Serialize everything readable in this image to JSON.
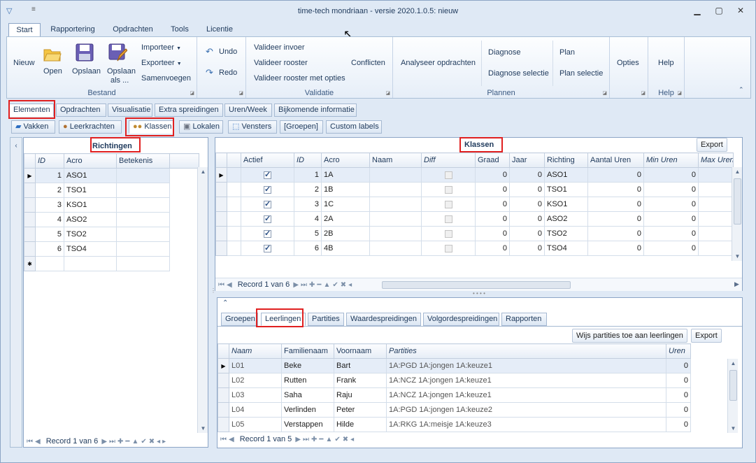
{
  "app": {
    "title": "time-tech mondriaan - versie 2020.1.0.5: nieuw"
  },
  "ribbon_tabs": [
    "Start",
    "Rapportering",
    "Opdrachten",
    "Tools",
    "Licentie"
  ],
  "ribbon": {
    "bestand": {
      "caption": "Bestand",
      "nieuw": "Nieuw",
      "open": "Open",
      "opslaan": "Opslaan",
      "opslaan_als_1": "Opslaan",
      "opslaan_als_2": "als ...",
      "importeer": "Importeer",
      "exporteer": "Exporteer",
      "samenvoegen": "Samenvoegen"
    },
    "undo": "Undo",
    "redo": "Redo",
    "validatie": {
      "caption": "Validatie",
      "valideer_invoer": "Valideer invoer",
      "valideer_rooster": "Valideer rooster",
      "valideer_opties": "Valideer rooster met opties",
      "conflicten": "Conflicten"
    },
    "plannen": {
      "caption": "Plannen",
      "analyseer": "Analyseer opdrachten",
      "diagnose": "Diagnose",
      "diagnose_selectie": "Diagnose selectie",
      "plan": "Plan",
      "plan_selectie": "Plan selectie"
    },
    "opties": "Opties",
    "help": {
      "caption": "Help",
      "label": "Help"
    }
  },
  "main_tabs": [
    "Elementen",
    "Opdrachten",
    "Visualisatie",
    "Extra spreidingen",
    "Uren/Week",
    "Bijkomende informatie"
  ],
  "element_tabs": [
    "Vakken",
    "Leerkrachten",
    "Klassen",
    "Lokalen",
    "Vensters",
    "[Groepen]",
    "Custom labels"
  ],
  "richtingen": {
    "title": "Richtingen",
    "columns": [
      "ID",
      "Acro",
      "Betekenis"
    ],
    "rows": [
      {
        "id": "1",
        "acro": "ASO1"
      },
      {
        "id": "2",
        "acro": "TSO1"
      },
      {
        "id": "3",
        "acro": "KSO1"
      },
      {
        "id": "4",
        "acro": "ASO2"
      },
      {
        "id": "5",
        "acro": "TSO2"
      },
      {
        "id": "6",
        "acro": "TSO4"
      }
    ],
    "record": "Record 1 van 6"
  },
  "klassen": {
    "title": "Klassen",
    "export": "Export",
    "columns": [
      "Actief",
      "ID",
      "Acro",
      "Naam",
      "Diff",
      "Graad",
      "Jaar",
      "Richting",
      "Aantal Uren",
      "Min Uren",
      "Max Uren"
    ],
    "rows": [
      {
        "actief": true,
        "id": "1",
        "acro": "1A",
        "graad": "0",
        "jaar": "0",
        "richting": "ASO1",
        "aantal": "0",
        "min": "0"
      },
      {
        "actief": true,
        "id": "2",
        "acro": "1B",
        "graad": "0",
        "jaar": "0",
        "richting": "TSO1",
        "aantal": "0",
        "min": "0"
      },
      {
        "actief": true,
        "id": "3",
        "acro": "1C",
        "graad": "0",
        "jaar": "0",
        "richting": "KSO1",
        "aantal": "0",
        "min": "0"
      },
      {
        "actief": true,
        "id": "4",
        "acro": "2A",
        "graad": "0",
        "jaar": "0",
        "richting": "ASO2",
        "aantal": "0",
        "min": "0"
      },
      {
        "actief": true,
        "id": "5",
        "acro": "2B",
        "graad": "0",
        "jaar": "0",
        "richting": "TSO2",
        "aantal": "0",
        "min": "0"
      },
      {
        "actief": true,
        "id": "6",
        "acro": "4B",
        "graad": "0",
        "jaar": "0",
        "richting": "TSO4",
        "aantal": "0",
        "min": "0"
      }
    ],
    "record": "Record 1 van 6"
  },
  "sub_tabs": [
    "Groepen",
    "Leerlingen",
    "Partities",
    "Waardespreidingen",
    "Volgordespreidingen",
    "Rapporten"
  ],
  "leerlingen": {
    "wijs_button": "Wijs partities toe aan leerlingen",
    "export": "Export",
    "columns": [
      "Naam",
      "Familienaam",
      "Voornaam",
      "Partities",
      "Uren"
    ],
    "rows": [
      {
        "naam": "L01",
        "familienaam": "Beke",
        "voornaam": "Bart",
        "partities": "1A:PGD 1A:jongen 1A:keuze1",
        "uren": "0"
      },
      {
        "naam": "L02",
        "familienaam": "Rutten",
        "voornaam": "Frank",
        "partities": "1A:NCZ 1A:jongen 1A:keuze1",
        "uren": "0"
      },
      {
        "naam": "L03",
        "familienaam": "Saha",
        "voornaam": "Raju",
        "partities": "1A:NCZ 1A:jongen 1A:keuze1",
        "uren": "0"
      },
      {
        "naam": "L04",
        "familienaam": "Verlinden",
        "voornaam": "Peter",
        "partities": "1A:PGD 1A:jongen 1A:keuze2",
        "uren": "0"
      },
      {
        "naam": "L05",
        "familienaam": "Verstappen",
        "voornaam": "Hilde",
        "partities": "1A:RKG 1A:meisje 1A:keuze3",
        "uren": "0"
      }
    ],
    "record": "Record 1 van 5"
  }
}
